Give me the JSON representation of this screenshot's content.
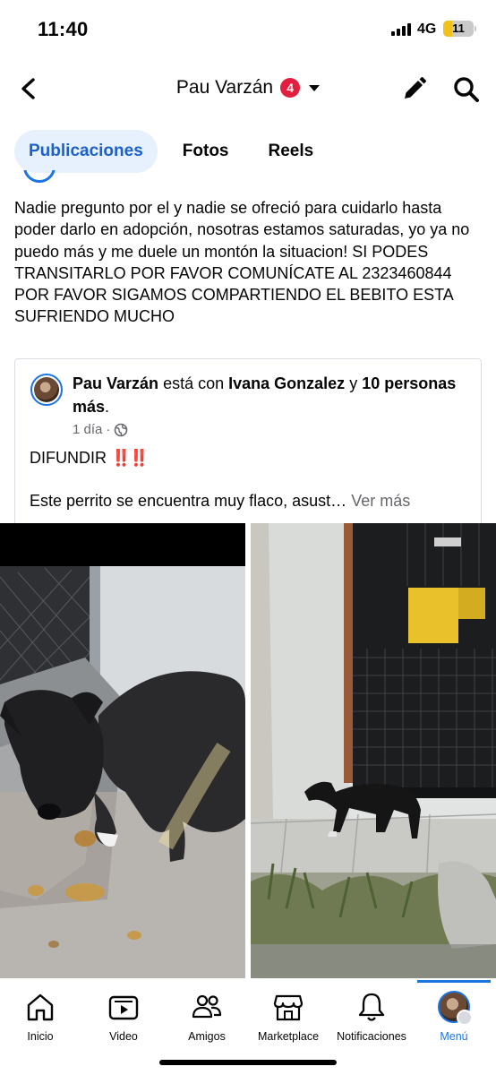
{
  "status_bar": {
    "time": "11:40",
    "network": "4G",
    "battery": "11",
    "battery_level": 0.11
  },
  "header": {
    "back_icon": "chevron-left-icon",
    "title": "Pau Varzán",
    "notification_count": "4",
    "edit_icon": "pencil-icon",
    "search_icon": "search-icon"
  },
  "tabs": [
    {
      "label": "Publicaciones",
      "active": true
    },
    {
      "label": "Fotos",
      "active": false
    },
    {
      "label": "Reels",
      "active": false
    }
  ],
  "post": {
    "text": "Nadie pregunto por el y nadie se ofreció para cuidarlo hasta poder darlo en adopción, nosotras estamos saturadas, yo ya no puedo más y me duele un montón la situacion! SI PODES TRANSITARLO POR FAVOR COMUNÍCATE AL 2323460844\nPOR FAVOR SIGAMOS COMPARTIENDO EL BEBITO ESTA SUFRIENDO MUCHO"
  },
  "shared_post": {
    "author": "Pau Varzán",
    "with_text": "está con",
    "tagged": "Ivana Gonzalez",
    "and_text": "y",
    "others": "10 personas más",
    "period": ".",
    "time": "1 día",
    "dot": "·",
    "difundir": "DIFUNDIR",
    "bangs": "‼️‼️",
    "description": "Este perrito se encuentra muy flaco, asust…",
    "see_more": "Ver más"
  },
  "bottom_nav": [
    {
      "label": "Inicio",
      "icon": "home-icon"
    },
    {
      "label": "Video",
      "icon": "video-icon"
    },
    {
      "label": "Amigos",
      "icon": "friends-icon"
    },
    {
      "label": "Marketplace",
      "icon": "marketplace-icon"
    },
    {
      "label": "Notificaciones",
      "icon": "bell-icon"
    },
    {
      "label": "Menú",
      "icon": "profile-avatar",
      "active": true
    }
  ],
  "colors": {
    "accent": "#1b74e4",
    "tab_active_bg": "#e7f0fd",
    "badge": "#e41e3f"
  }
}
